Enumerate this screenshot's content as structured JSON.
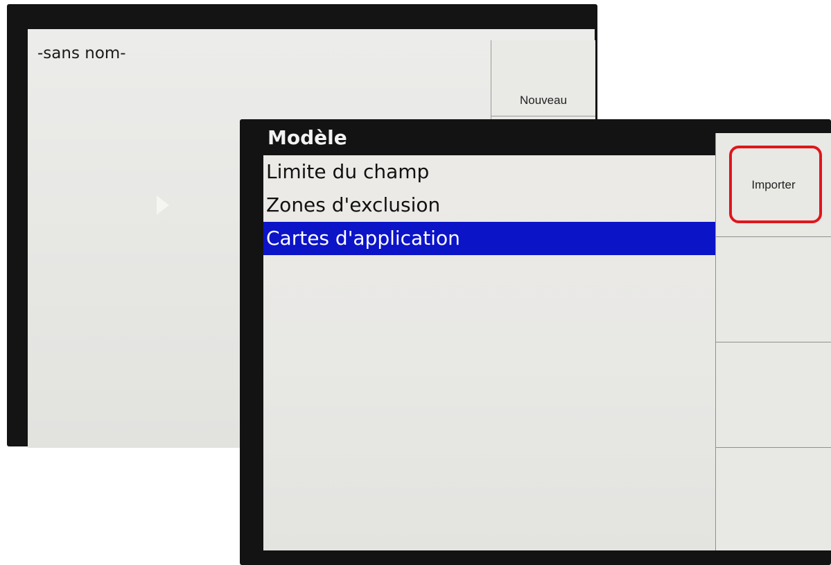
{
  "back_screen": {
    "title": "-sans nom-",
    "button_label": "Nouveau"
  },
  "front_screen": {
    "header": "Modèle",
    "items": [
      {
        "label": "Limite du champ",
        "selected": false
      },
      {
        "label": "Zones d'exclusion",
        "selected": false
      },
      {
        "label": "Cartes d'application",
        "selected": true
      }
    ],
    "sidebar_buttons": [
      {
        "label": "Importer",
        "highlighted": true
      },
      {
        "label": ""
      },
      {
        "label": ""
      },
      {
        "label": ""
      }
    ]
  },
  "colors": {
    "selection": "#0c14c8",
    "highlight_outline": "#e0161b",
    "bezel": "#131313",
    "screen": "#e9e9e6"
  }
}
